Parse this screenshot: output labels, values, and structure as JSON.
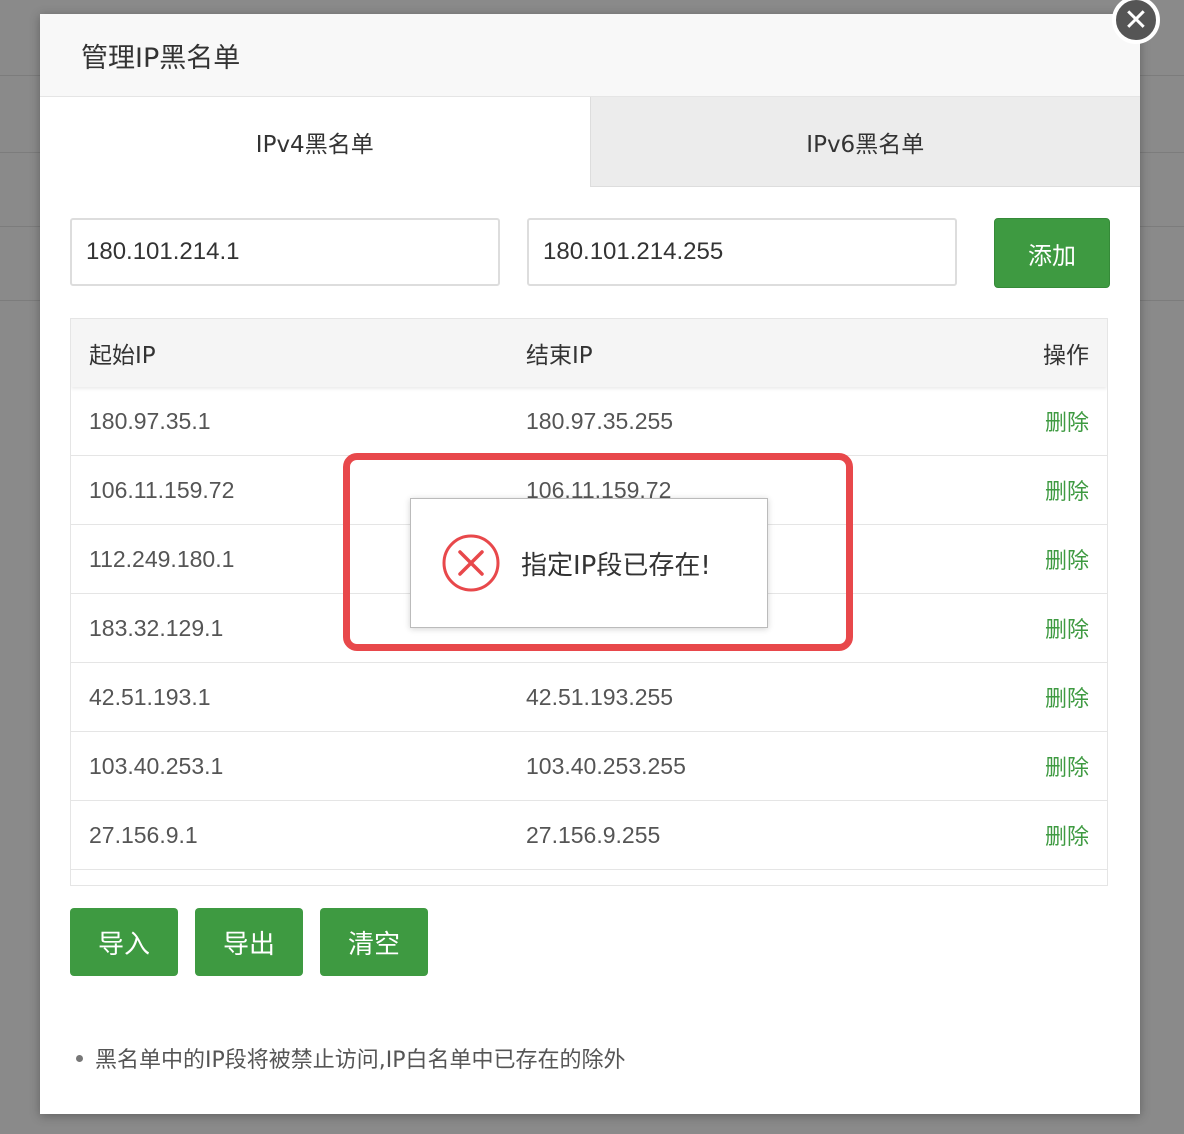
{
  "modal": {
    "title": "管理IP黑名单",
    "close_glyph": "✕"
  },
  "tabs": [
    {
      "label": "IPv4黑名单",
      "active": true
    },
    {
      "label": "IPv6黑名单",
      "active": false
    }
  ],
  "form": {
    "start_ip_value": "180.101.214.1",
    "end_ip_value": "180.101.214.255",
    "add_label": "添加"
  },
  "table": {
    "headers": {
      "start": "起始IP",
      "end": "结束IP",
      "op": "操作"
    },
    "rows": [
      {
        "start": "180.97.35.1",
        "end": "180.97.35.255",
        "op": "删除"
      },
      {
        "start": "106.11.159.72",
        "end": "106.11.159.72",
        "op": "删除"
      },
      {
        "start": "112.249.180.1",
        "end": "",
        "op": "删除"
      },
      {
        "start": "183.32.129.1",
        "end": "",
        "op": "删除"
      },
      {
        "start": "42.51.193.1",
        "end": "42.51.193.255",
        "op": "删除"
      },
      {
        "start": "103.40.253.1",
        "end": "103.40.253.255",
        "op": "删除"
      },
      {
        "start": "27.156.9.1",
        "end": "27.156.9.255",
        "op": "删除"
      }
    ]
  },
  "actions": {
    "import": "导入",
    "export": "导出",
    "clear": "清空"
  },
  "note": "黑名单中的IP段将被禁止访问,IP白名单中已存在的除外",
  "toast": {
    "message": "指定IP段已存在!",
    "icon": "error-circle-icon"
  },
  "colors": {
    "primary_green": "#3e9a41",
    "error_red": "#e8484b"
  }
}
